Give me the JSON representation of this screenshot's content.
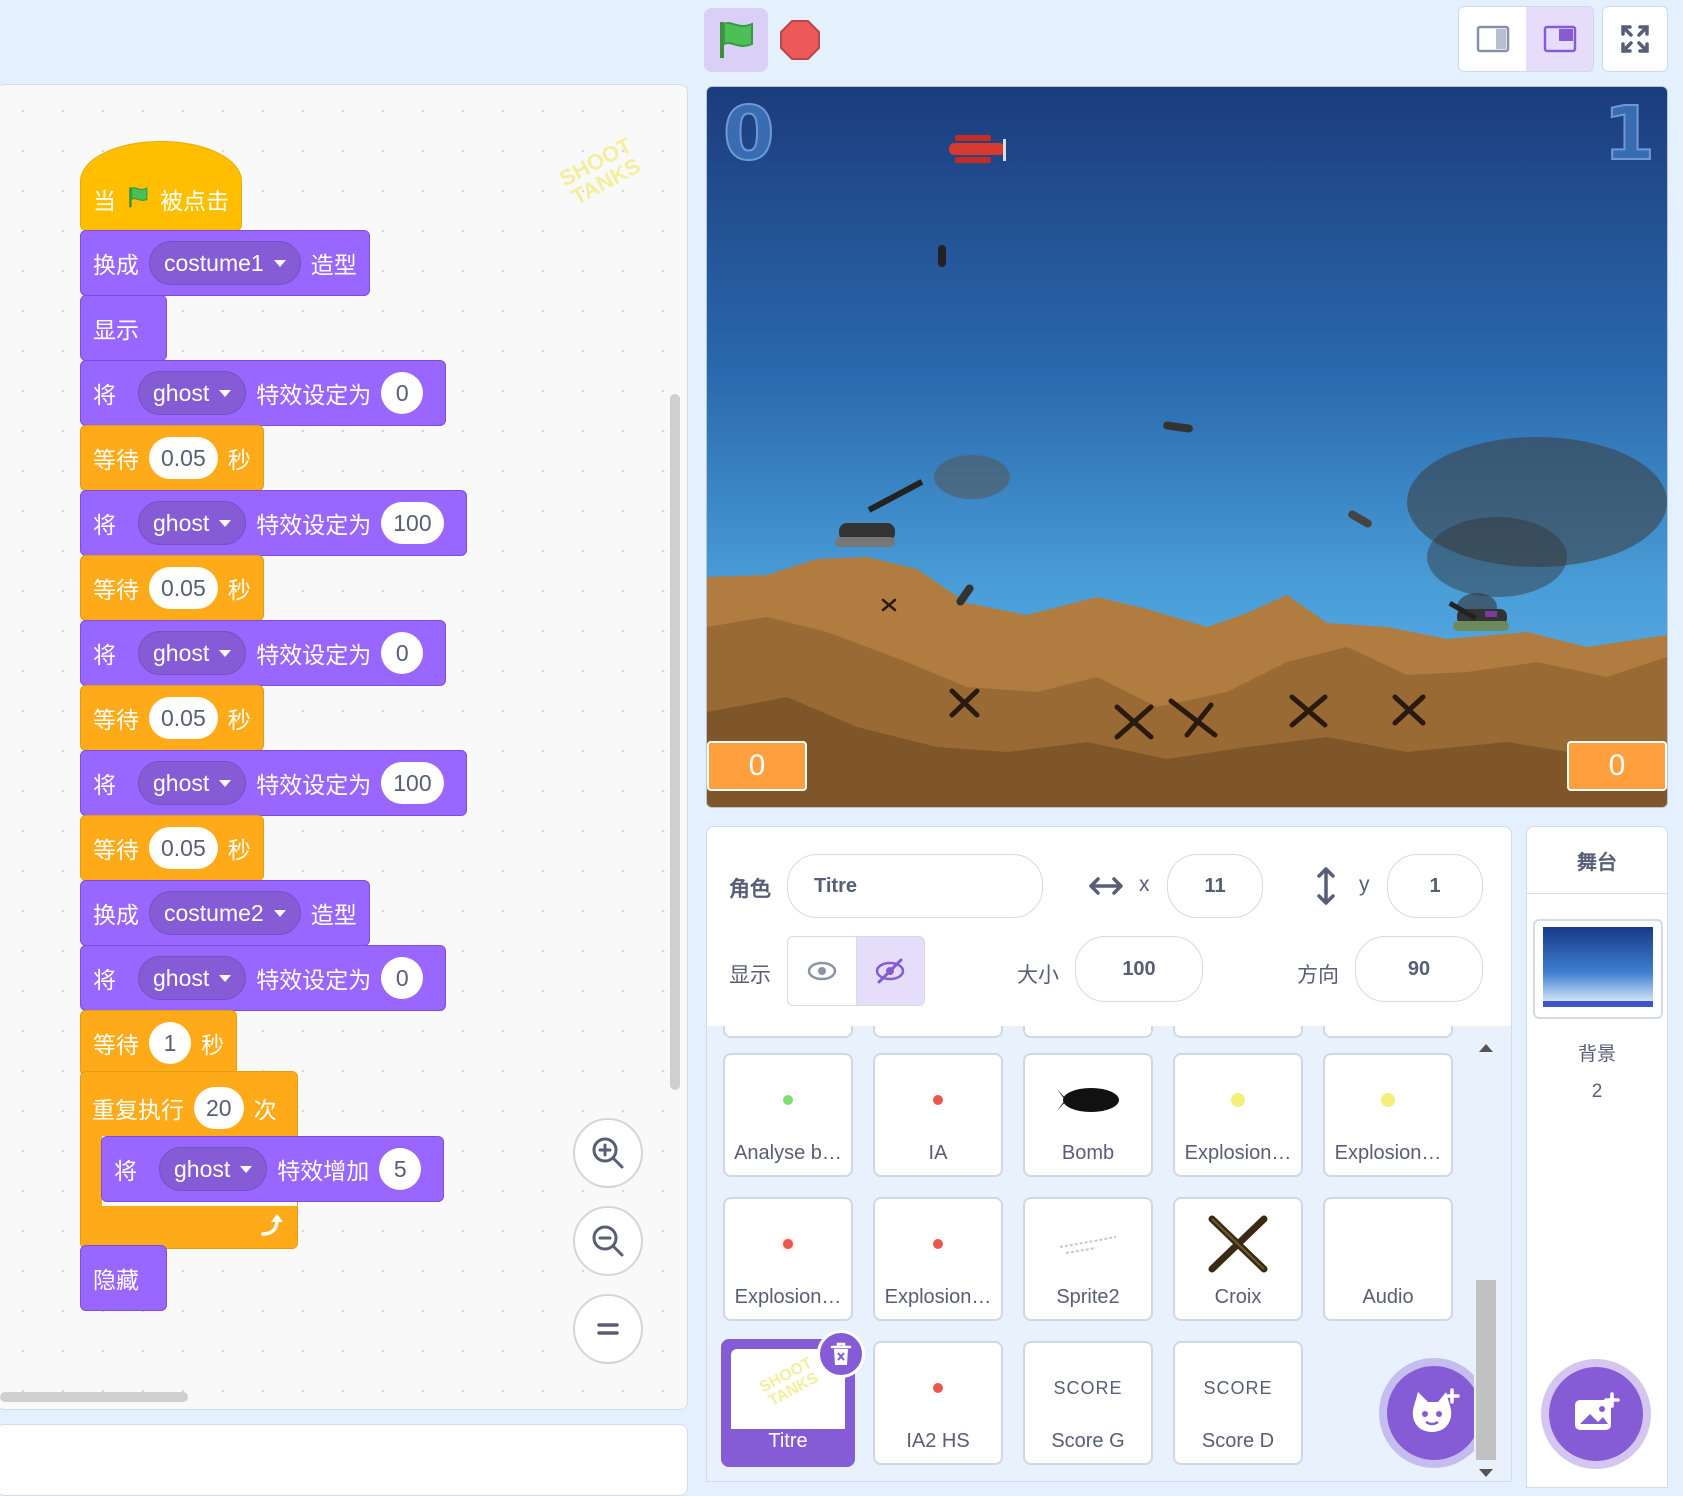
{
  "watermark": "SHOOT TANKS",
  "blocks": {
    "hat": {
      "when": "当",
      "clicked": "被点击"
    },
    "switch1": {
      "label": "换成",
      "costume": "costume1",
      "suffix": "造型"
    },
    "show": "显示",
    "set1": {
      "label": "将",
      "effect": "ghost",
      "mid": "特效设定为",
      "value": "0"
    },
    "wait1": {
      "label": "等待",
      "value": "0.05",
      "unit": "秒"
    },
    "set2": {
      "label": "将",
      "effect": "ghost",
      "mid": "特效设定为",
      "value": "100"
    },
    "wait2": {
      "label": "等待",
      "value": "0.05",
      "unit": "秒"
    },
    "set3": {
      "label": "将",
      "effect": "ghost",
      "mid": "特效设定为",
      "value": "0"
    },
    "wait3": {
      "label": "等待",
      "value": "0.05",
      "unit": "秒"
    },
    "set4": {
      "label": "将",
      "effect": "ghost",
      "mid": "特效设定为",
      "value": "100"
    },
    "wait4": {
      "label": "等待",
      "value": "0.05",
      "unit": "秒"
    },
    "switch2": {
      "label": "换成",
      "costume": "costume2",
      "suffix": "造型"
    },
    "set5": {
      "label": "将",
      "effect": "ghost",
      "mid": "特效设定为",
      "value": "0"
    },
    "wait5": {
      "label": "等待",
      "value": "1",
      "unit": "秒"
    },
    "repeat": {
      "label": "重复执行",
      "value": "20",
      "unit": "次"
    },
    "change": {
      "label": "将",
      "effect": "ghost",
      "mid": "特效增加",
      "value": "5"
    },
    "hide": "隐藏"
  },
  "stage": {
    "score_left_big": "0",
    "score_right_big": "1",
    "score_left_box": "0",
    "score_right_box": "0"
  },
  "sprite_info": {
    "sprite_label": "角色",
    "sprite_name": "Titre",
    "x_label": "x",
    "x_value": "11",
    "y_label": "y",
    "y_value": "1",
    "show_label": "显示",
    "size_label": "大小",
    "size_value": "100",
    "direction_label": "方向",
    "direction_value": "90"
  },
  "sprites": [
    {
      "name": "Analyse b…",
      "dot": "#7ddf6e"
    },
    {
      "name": "IA",
      "dot": "#e8584f"
    },
    {
      "name": "Bomb",
      "dot": ""
    },
    {
      "name": "Explosion…",
      "dot": "#f3f07a"
    },
    {
      "name": "Explosion…",
      "dot": "#f3f07a"
    },
    {
      "name": "Explosion…",
      "dot": "#e8584f"
    },
    {
      "name": "Explosion…",
      "dot": "#e8584f"
    },
    {
      "name": "Sprite2",
      "dot": ""
    },
    {
      "name": "Croix",
      "dot": ""
    },
    {
      "name": "Audio",
      "dot": ""
    },
    {
      "name": "Titre",
      "dot": ""
    },
    {
      "name": "IA2 HS",
      "dot": "#e8584f"
    },
    {
      "name": "Score G",
      "thumb_text": "SCORE"
    },
    {
      "name": "Score D",
      "thumb_text": "SCORE"
    }
  ],
  "stage_panel": {
    "title": "舞台",
    "backdrops_label": "背景",
    "backdrops_count": "2"
  },
  "colors": {
    "accent": "#855cd6",
    "looks_block": "#9966ff",
    "control_block": "#ffab19",
    "events_block": "#ffbf00",
    "score_box": "#ff9f3e"
  }
}
